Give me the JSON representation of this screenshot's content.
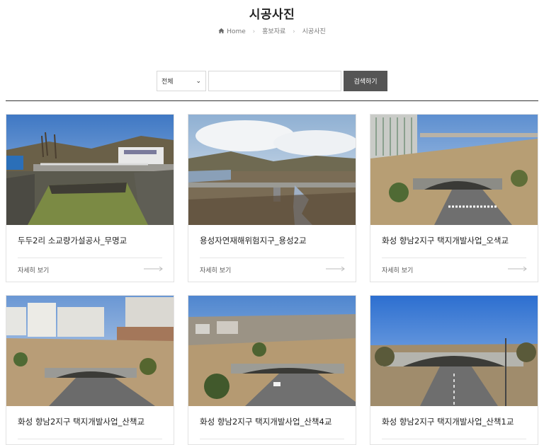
{
  "page": {
    "title": "시공사진"
  },
  "breadcrumb": {
    "home": "Home",
    "parent": "홍보자료",
    "current": "시공사진"
  },
  "search": {
    "select_value": "전체",
    "input_value": "",
    "button_label": "검색하기"
  },
  "cards": [
    {
      "title": "두두2리 소교량가설공사_무명교",
      "more_label": "자세히 보기",
      "photo_icon": "bridge-photo"
    },
    {
      "title": "용성자연재해위험지구_용성2교",
      "more_label": "자세히 보기",
      "photo_icon": "bridge-photo"
    },
    {
      "title": "화성 향남2지구 택지개발사업_오색교",
      "more_label": "자세히 보기",
      "photo_icon": "bridge-photo"
    },
    {
      "title": "화성 향남2지구 택지개발사업_산책교",
      "more_label": "",
      "photo_icon": "bridge-photo"
    },
    {
      "title": "화성 향남2지구 택지개발사업_산책4교",
      "more_label": "",
      "photo_icon": "bridge-photo"
    },
    {
      "title": "화성 향남2지구 택지개발사업_산책1교",
      "more_label": "",
      "photo_icon": "bridge-photo"
    }
  ],
  "colors": {
    "button_bg": "#555555",
    "divider": "#333333",
    "text": "#222222"
  }
}
